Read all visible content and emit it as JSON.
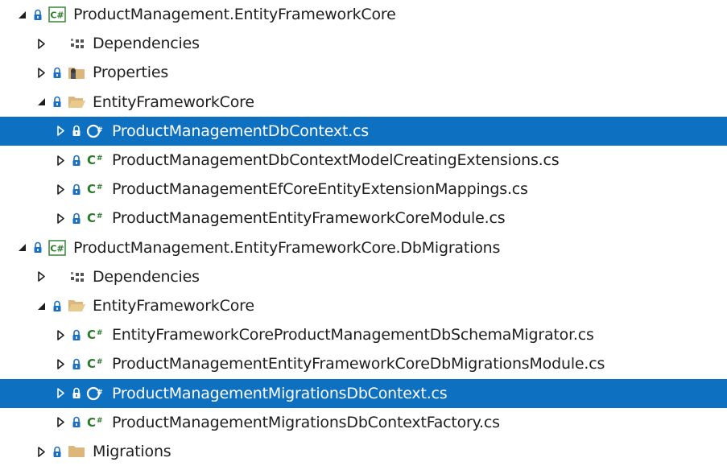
{
  "solution_explorer": {
    "rows": [
      {
        "label": "ProductManagement.EntityFrameworkCore",
        "icon": "csharp-project-icon",
        "expand": "expanded",
        "level": 0,
        "lock": true,
        "selected": false
      },
      {
        "label": "Dependencies",
        "icon": "dependencies-icon",
        "expand": "collapsed",
        "level": 1,
        "lock": false,
        "selected": false
      },
      {
        "label": "Properties",
        "icon": "properties-folder-icon",
        "expand": "collapsed",
        "level": 1,
        "lock": true,
        "selected": false
      },
      {
        "label": "EntityFrameworkCore",
        "icon": "folder-open-icon",
        "expand": "expanded",
        "level": 1,
        "lock": true,
        "selected": false
      },
      {
        "label": "ProductManagementDbContext.cs",
        "icon": "csharp-file-icon",
        "expand": "collapsed",
        "level": 2,
        "lock": true,
        "selected": true
      },
      {
        "label": "ProductManagementDbContextModelCreatingExtensions.cs",
        "icon": "csharp-file-icon",
        "expand": "collapsed",
        "level": 2,
        "lock": true,
        "selected": false
      },
      {
        "label": "ProductManagementEfCoreEntityExtensionMappings.cs",
        "icon": "csharp-file-icon",
        "expand": "collapsed",
        "level": 2,
        "lock": true,
        "selected": false
      },
      {
        "label": "ProductManagementEntityFrameworkCoreModule.cs",
        "icon": "csharp-file-icon",
        "expand": "collapsed",
        "level": 2,
        "lock": true,
        "selected": false
      },
      {
        "label": "ProductManagement.EntityFrameworkCore.DbMigrations",
        "icon": "csharp-project-icon",
        "expand": "expanded",
        "level": 0,
        "lock": true,
        "selected": false
      },
      {
        "label": "Dependencies",
        "icon": "dependencies-icon",
        "expand": "collapsed",
        "level": 1,
        "lock": false,
        "selected": false
      },
      {
        "label": "EntityFrameworkCore",
        "icon": "folder-open-icon",
        "expand": "expanded",
        "level": 1,
        "lock": true,
        "selected": false
      },
      {
        "label": "EntityFrameworkCoreProductManagementDbSchemaMigrator.cs",
        "icon": "csharp-file-icon",
        "expand": "collapsed",
        "level": 2,
        "lock": true,
        "selected": false
      },
      {
        "label": "ProductManagementEntityFrameworkCoreDbMigrationsModule.cs",
        "icon": "csharp-file-icon",
        "expand": "collapsed",
        "level": 2,
        "lock": true,
        "selected": false
      },
      {
        "label": "ProductManagementMigrationsDbContext.cs",
        "icon": "csharp-file-icon",
        "expand": "collapsed",
        "level": 2,
        "lock": true,
        "selected": true
      },
      {
        "label": "ProductManagementMigrationsDbContextFactory.cs",
        "icon": "csharp-file-icon",
        "expand": "collapsed",
        "level": 2,
        "lock": true,
        "selected": false
      },
      {
        "label": "Migrations",
        "icon": "folder-icon",
        "expand": "collapsed",
        "level": 1,
        "lock": true,
        "selected": false
      }
    ]
  },
  "colors": {
    "selection": "#0e70c0",
    "text": "#1e1e1e",
    "folder": "#dcb67a",
    "csharp_green": "#2a7a2a",
    "lock_blue": "#1c6fbf"
  }
}
